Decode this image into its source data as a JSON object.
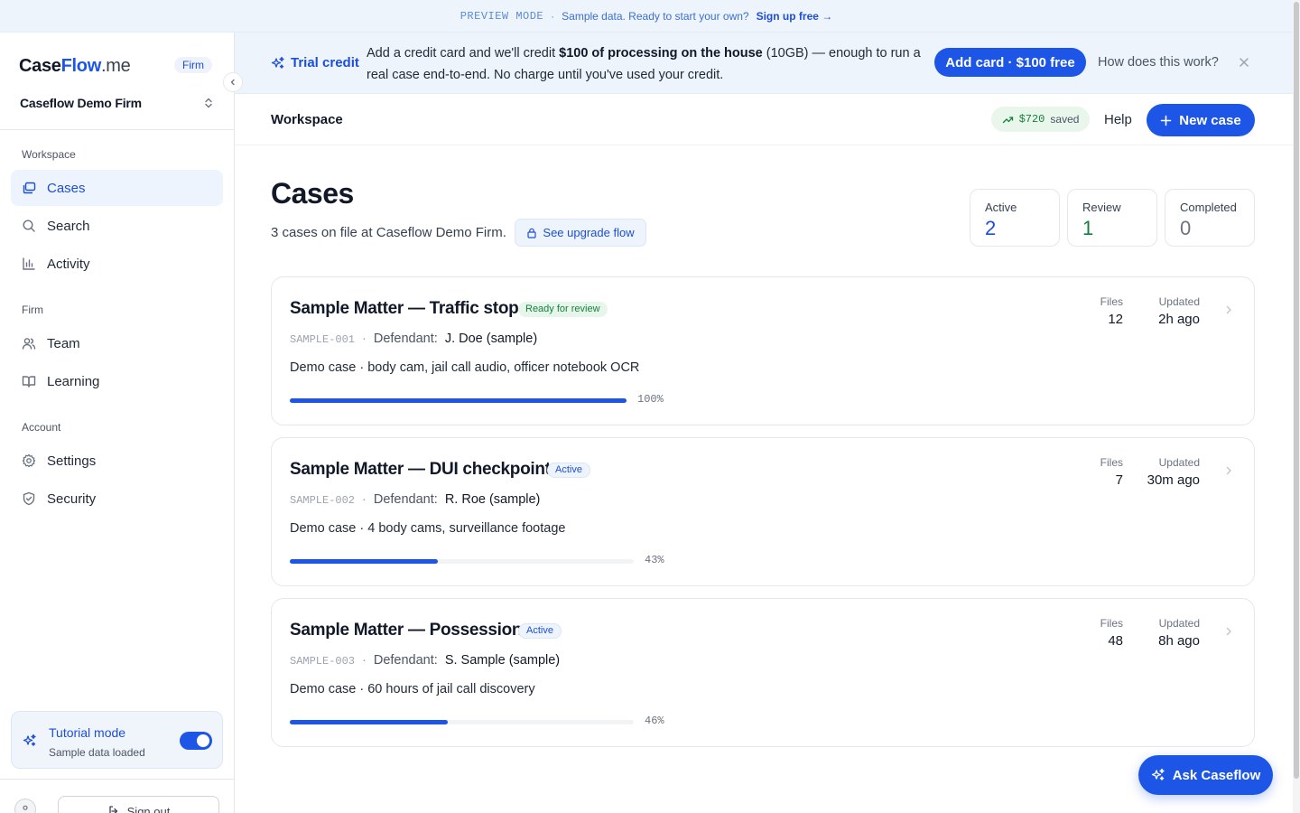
{
  "preview": {
    "mode": "PREVIEW MODE",
    "separator": "·",
    "message": "Sample data. Ready to start your own?",
    "cta": "Sign up free →"
  },
  "sidebar": {
    "brand": {
      "part1": "Case",
      "part2": "Flow",
      "part3": ".me"
    },
    "badge": "Firm",
    "firm_name": "Caseflow Demo Firm",
    "sections": {
      "workspace": "Workspace",
      "firm": "Firm",
      "account": "Account"
    },
    "items": {
      "cases": {
        "label": "Cases",
        "icon": "cases-icon",
        "active": true
      },
      "search": {
        "label": "Search",
        "icon": "search-icon"
      },
      "activity": {
        "label": "Activity",
        "icon": "bar-chart-icon"
      },
      "team": {
        "label": "Team",
        "icon": "users-icon"
      },
      "learning": {
        "label": "Learning",
        "icon": "book-icon"
      },
      "settings": {
        "label": "Settings",
        "icon": "gear-icon"
      },
      "security": {
        "label": "Security",
        "icon": "shield-icon"
      }
    },
    "tutorial": {
      "title": "Tutorial mode",
      "subtitle": "Sample data loaded",
      "enabled": true
    },
    "signout": "Sign out"
  },
  "trial": {
    "label": "Trial credit",
    "text_pre": "Add a credit card and we'll credit ",
    "text_bold": "$100 of processing on the house",
    "text_post": " (10GB) — enough to run a real case end-to-end. No charge until you've used your credit.",
    "button": "Add card · $100 free",
    "help": "How does this work?"
  },
  "header": {
    "breadcrumb": "Workspace",
    "saved_amount": "$720",
    "saved_label": "saved",
    "help": "Help",
    "new_case": "New case"
  },
  "main": {
    "title": "Cases",
    "subtitle": "3 cases on file at Caseflow Demo Firm.",
    "upgrade": "See upgrade flow",
    "stats": [
      {
        "label": "Active",
        "value": "2",
        "color": "#1d4ed8"
      },
      {
        "label": "Review",
        "value": "1",
        "color": "#15803d"
      },
      {
        "label": "Completed",
        "value": "0",
        "color": "#6b7280"
      }
    ],
    "files_header": "Files",
    "updated_header": "Updated",
    "cases": [
      {
        "title": "Sample Matter — Traffic stop",
        "status": "Ready for review",
        "id": "SAMPLE-001",
        "defendant_label": "Defendant:",
        "defendant": "J. Doe (sample)",
        "description": "Demo case · body cam, jail call audio, officer notebook OCR",
        "progress": 1.0,
        "progress_label": "100%",
        "files": "12",
        "updated": "2h ago"
      },
      {
        "title": "Sample Matter — DUI checkpoint",
        "status": "Active",
        "id": "SAMPLE-002",
        "defendant_label": "Defendant:",
        "defendant": "R. Roe (sample)",
        "description": "Demo case · 4 body cams, surveillance footage",
        "progress": 0.43,
        "progress_label": "43%",
        "files": "7",
        "updated": "30m ago"
      },
      {
        "title": "Sample Matter — Possession",
        "status": "Active",
        "id": "SAMPLE-003",
        "defendant_label": "Defendant:",
        "defendant": "S. Sample (sample)",
        "description": "Demo case · 60 hours of jail call discovery",
        "progress": 0.46,
        "progress_label": "46%",
        "files": "48",
        "updated": "8h ago"
      }
    ]
  },
  "assistant": {
    "label": "Ask Caseflow",
    "icon": "sparkles-icon"
  },
  "colors": {
    "accent": "#1d56e6",
    "review": "#15803d",
    "banner": "#eef4fc"
  }
}
